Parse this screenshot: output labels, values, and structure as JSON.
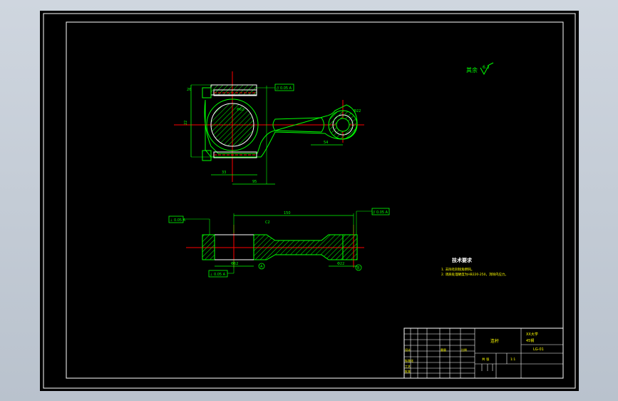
{
  "roughness": {
    "label": "其余",
    "value": "6.3"
  },
  "top_view": {
    "dims": {
      "d1": "22",
      "d2": "33",
      "d3": "Φ62",
      "d4": "26",
      "d5": "95",
      "d6": "54"
    },
    "tol_frames": [
      "// 0.05 A"
    ],
    "labels": {
      "phi_small": "Φ22"
    }
  },
  "bottom_view": {
    "dims": {
      "length": "150",
      "phi_left": "Φ62",
      "phi_right": "Φ22",
      "datum": "A",
      "datum2": "B",
      "chamfer": "C2"
    },
    "tol_frames": [
      "⊥ 0.05 A",
      "// 0.05 A",
      "⊥ 0.05 A"
    ]
  },
  "requirements": {
    "title": "技术要求",
    "lines": [
      "1. 去除毛刺锐角倒钝。",
      "2. 调质处理硬度为HB220-250，消除内应力。"
    ]
  },
  "title_block": {
    "part_name": "连杆",
    "school": "XX大学",
    "scale": "1:1",
    "material": "45钢",
    "drawing_no": "LG-01",
    "designer_label": "设计",
    "weight_label": "重量",
    "scale_label": "比例",
    "sheet_label": "共 张",
    "std_label": "标准化",
    "process_label": "工艺",
    "approve_label": "批准"
  }
}
